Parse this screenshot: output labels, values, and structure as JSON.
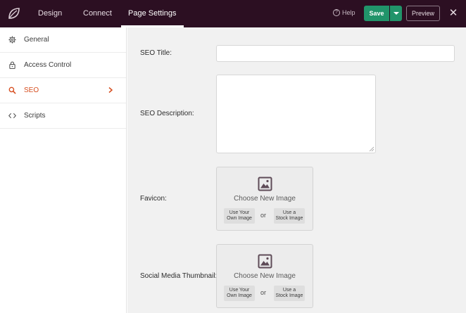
{
  "topbar": {
    "tabs": [
      {
        "label": "Design"
      },
      {
        "label": "Connect"
      },
      {
        "label": "Page Settings"
      }
    ],
    "help_label": "Help",
    "help_icon_glyph": "?",
    "save_label": "Save",
    "preview_label": "Preview",
    "close_glyph": "✕"
  },
  "sidebar": {
    "items": [
      {
        "label": "General",
        "icon": "gear-icon"
      },
      {
        "label": "Access Control",
        "icon": "lock-icon"
      },
      {
        "label": "SEO",
        "icon": "search-icon",
        "active": true
      },
      {
        "label": "Scripts",
        "icon": "code-icon"
      }
    ]
  },
  "form": {
    "seo_title_label": "SEO Title:",
    "seo_title_value": "",
    "seo_description_label": "SEO Description:",
    "seo_description_value": "",
    "favicon_label": "Favicon:",
    "social_thumbnail_label": "Social Media Thumbnail:",
    "choose_image_label": "Choose New Image",
    "use_own_line1": "Use Your",
    "use_own_line2": "Own Image",
    "or_label": "or",
    "stock_line1": "Use a",
    "stock_line2": "Stock Image"
  },
  "colors": {
    "topbar_bg": "#2c0f22",
    "save_green": "#21946a",
    "active_orange": "#d64d1e"
  }
}
